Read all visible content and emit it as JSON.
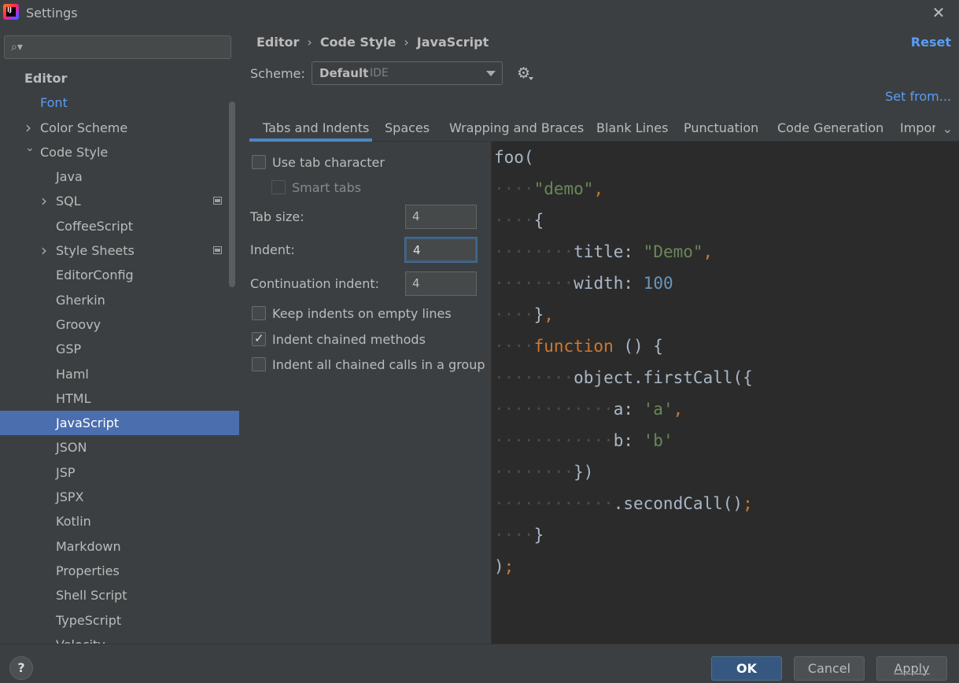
{
  "window": {
    "app_icon": "IntelliJ IDEA",
    "app_icon_text": "IJ",
    "title": "Settings",
    "close_glyph": "✕"
  },
  "sidebar": {
    "search_placeholder": "",
    "search_icon": "search-icon",
    "items": [
      {
        "label": "Editor",
        "type": "header"
      },
      {
        "label": "Font",
        "type": "font"
      },
      {
        "label": "Color Scheme",
        "type": "l1",
        "expandable": true,
        "expanded": false
      },
      {
        "label": "Code Style",
        "type": "l1",
        "expandable": true,
        "expanded": true
      },
      {
        "label": "Java",
        "type": "l2"
      },
      {
        "label": "SQL",
        "type": "l2",
        "expandable": true,
        "project_icon": true
      },
      {
        "label": "CoffeeScript",
        "type": "l2"
      },
      {
        "label": "Style Sheets",
        "type": "l2",
        "expandable": true,
        "project_icon": true
      },
      {
        "label": "EditorConfig",
        "type": "l2"
      },
      {
        "label": "Gherkin",
        "type": "l2"
      },
      {
        "label": "Groovy",
        "type": "l2"
      },
      {
        "label": "GSP",
        "type": "l2"
      },
      {
        "label": "Haml",
        "type": "l2"
      },
      {
        "label": "HTML",
        "type": "l2"
      },
      {
        "label": "JavaScript",
        "type": "l2",
        "selected": true
      },
      {
        "label": "JSON",
        "type": "l2"
      },
      {
        "label": "JSP",
        "type": "l2"
      },
      {
        "label": "JSPX",
        "type": "l2"
      },
      {
        "label": "Kotlin",
        "type": "l2"
      },
      {
        "label": "Markdown",
        "type": "l2"
      },
      {
        "label": "Properties",
        "type": "l2"
      },
      {
        "label": "Shell Script",
        "type": "l2"
      },
      {
        "label": "TypeScript",
        "type": "l2"
      },
      {
        "label": "Velocity",
        "type": "l2"
      }
    ]
  },
  "main": {
    "breadcrumb": [
      "Editor",
      "Code Style",
      "JavaScript"
    ],
    "breadcrumb_sep": "›",
    "reset_label": "Reset",
    "scheme_label": "Scheme:",
    "scheme_value": "Default",
    "scheme_sub": "IDE",
    "set_from_label": "Set from...",
    "tabs": [
      "Tabs and Indents",
      "Spaces",
      "Wrapping and Braces",
      "Blank Lines",
      "Punctuation",
      "Code Generation",
      "Imports"
    ],
    "active_tab": "Tabs and Indents",
    "options": {
      "use_tab_character": {
        "label": "Use tab character",
        "checked": false
      },
      "smart_tabs": {
        "label": "Smart tabs",
        "checked": false,
        "disabled": true
      },
      "tab_size": {
        "label": "Tab size:",
        "value": "4"
      },
      "indent": {
        "label": "Indent:",
        "value": "4"
      },
      "continuation_indent": {
        "label": "Continuation indent:",
        "value": "4"
      },
      "keep_indents_empty": {
        "label": "Keep indents on empty lines",
        "checked": false
      },
      "indent_chained_methods": {
        "label": "Indent chained methods",
        "checked": true
      },
      "indent_chained_group": {
        "label": "Indent all chained calls in a group",
        "checked": false
      }
    }
  },
  "preview": {
    "lines": [
      {
        "indent": 0,
        "tokens": [
          [
            "t",
            "foo("
          ]
        ]
      },
      {
        "indent": 1,
        "tokens": [
          [
            "str",
            "\"demo\""
          ],
          [
            "p",
            ","
          ]
        ]
      },
      {
        "indent": 1,
        "tokens": [
          [
            "t",
            "{"
          ]
        ]
      },
      {
        "indent": 2,
        "tokens": [
          [
            "t",
            "title: "
          ],
          [
            "str",
            "\"Demo\""
          ],
          [
            "p",
            ","
          ]
        ]
      },
      {
        "indent": 2,
        "tokens": [
          [
            "t",
            "width: "
          ],
          [
            "num",
            "100"
          ]
        ]
      },
      {
        "indent": 1,
        "tokens": [
          [
            "t",
            "}"
          ],
          [
            "p",
            ","
          ]
        ]
      },
      {
        "indent": 1,
        "tokens": [
          [
            "kw",
            "function"
          ],
          [
            "t",
            " () {"
          ]
        ]
      },
      {
        "indent": 2,
        "tokens": [
          [
            "t",
            "object.firstCall({"
          ]
        ]
      },
      {
        "indent": 3,
        "tokens": [
          [
            "t",
            "a: "
          ],
          [
            "str",
            "'a'"
          ],
          [
            "p",
            ","
          ]
        ]
      },
      {
        "indent": 3,
        "tokens": [
          [
            "t",
            "b: "
          ],
          [
            "str",
            "'b'"
          ]
        ]
      },
      {
        "indent": 2,
        "tokens": [
          [
            "t",
            "})"
          ]
        ]
      },
      {
        "indent": 3,
        "tokens": [
          [
            "t",
            ".secondCall()"
          ],
          [
            "p",
            ";"
          ]
        ]
      },
      {
        "indent": 1,
        "tokens": [
          [
            "t",
            "}"
          ]
        ]
      },
      {
        "indent": 0,
        "tokens": [
          [
            "t",
            ")"
          ],
          [
            "p",
            ";"
          ]
        ]
      }
    ]
  },
  "footer": {
    "help_label": "?",
    "ok_label": "OK",
    "cancel_label": "Cancel",
    "apply_label": "Apply"
  },
  "colors": {
    "background": "#3c3f41",
    "editor_background": "#2b2b2b",
    "selection": "#4b6eaf",
    "link": "#589df6",
    "keyword": "#cc7832",
    "string": "#6a8759",
    "number": "#6897bb",
    "primary_button": "#365880"
  }
}
